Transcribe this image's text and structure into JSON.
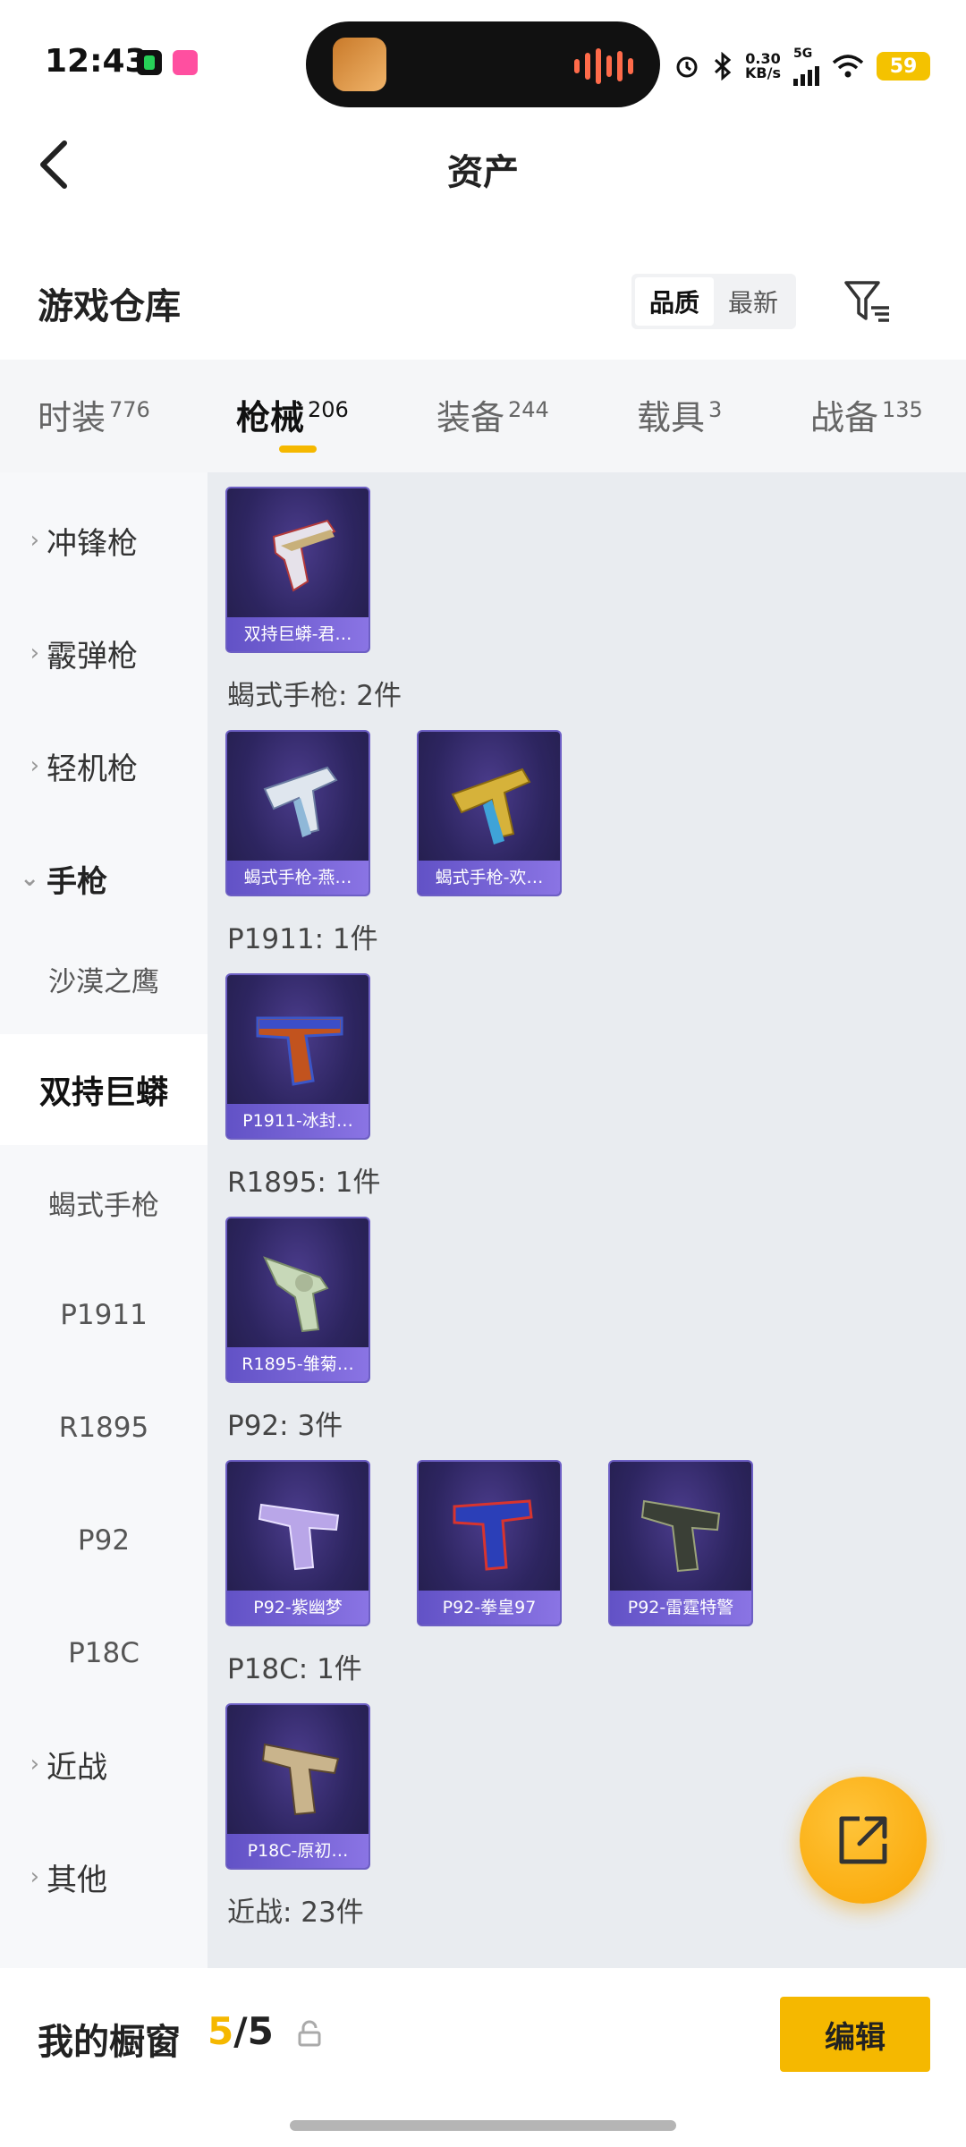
{
  "status": {
    "time": "12:43",
    "speed_value": "0.30",
    "speed_unit": "KB/s",
    "network": "5G",
    "battery": "59"
  },
  "header": {
    "title": "资产"
  },
  "warehouse": {
    "title": "游戏仓库",
    "sort_options": [
      "品质",
      "最新"
    ],
    "active_sort": "品质"
  },
  "tabs": [
    {
      "label": "时装",
      "count": "776"
    },
    {
      "label": "枪械",
      "count": "206"
    },
    {
      "label": "装备",
      "count": "244"
    },
    {
      "label": "载具",
      "count": "3"
    },
    {
      "label": "战备",
      "count": "135"
    }
  ],
  "active_tab": "枪械",
  "sidebar": {
    "categories": [
      "冲锋枪",
      "霰弹枪",
      "轻机枪",
      "手枪",
      "近战",
      "其他"
    ],
    "open_category": "手枪",
    "pistol_subs": [
      "沙漠之鹰",
      "双持巨蟒",
      "蝎式手枪",
      "P1911",
      "R1895",
      "P92",
      "P18C"
    ],
    "selected_sub": "双持巨蟒"
  },
  "groups": [
    {
      "label": "",
      "items": [
        "双持巨蟒-君…"
      ]
    },
    {
      "label": "蝎式手枪: 2件",
      "items": [
        "蝎式手枪-燕…",
        "蝎式手枪-欢…"
      ]
    },
    {
      "label": "P1911: 1件",
      "items": [
        "P1911-冰封…"
      ]
    },
    {
      "label": "R1895: 1件",
      "items": [
        "R1895-雏菊…"
      ]
    },
    {
      "label": "P92: 3件",
      "items": [
        "P92-紫幽梦",
        "P92-拳皇97",
        "P92-雷霆特警"
      ]
    },
    {
      "label": "P18C: 1件",
      "items": [
        "P18C-原初…"
      ]
    },
    {
      "label": "近战: 23件",
      "items": []
    }
  ],
  "bottom": {
    "showcase_label": "我的橱窗",
    "showcase_used": "5",
    "showcase_sep": "/",
    "showcase_total": "5",
    "edit_label": "编辑"
  },
  "colors": {
    "accent": "#f5b800",
    "card_bg": "#2d2560",
    "card_label": "#7a66d8"
  },
  "icons": [
    "back-arrow-icon",
    "filter-icon",
    "chevron-right-icon",
    "chevron-down-icon",
    "share-external-icon",
    "lock-icon"
  ]
}
